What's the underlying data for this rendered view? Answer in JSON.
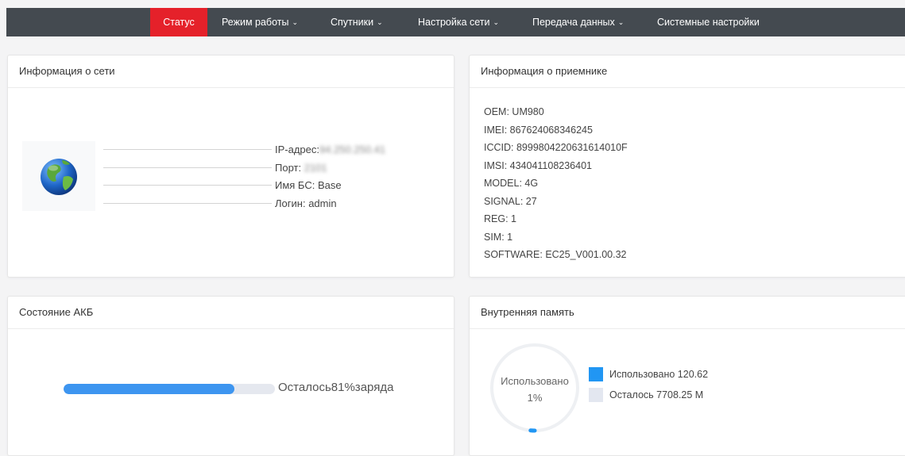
{
  "nav": {
    "items": [
      {
        "label": "Статус",
        "dropdown": false,
        "active": true
      },
      {
        "label": "Режим работы",
        "dropdown": true
      },
      {
        "label": "Спутники",
        "dropdown": true
      },
      {
        "label": "Настройка сети",
        "dropdown": true
      },
      {
        "label": "Передача данных",
        "dropdown": true
      },
      {
        "label": "Системные настройки",
        "dropdown": false
      }
    ],
    "dropdown_icon": "chevron-down-icon",
    "active_color": "#e5212a",
    "bar_color": "#444a50"
  },
  "network": {
    "title": "Информация о сети",
    "icon": "globe-icon",
    "ip_label": "IP-адрес:",
    "ip_value": "94.250.250.41",
    "port_label": "Порт:",
    "port_value": "2101",
    "bs_label": "Имя БС:",
    "bs_value": "Base",
    "login_label": "Логин:",
    "login_value": "admin"
  },
  "receiver": {
    "title": "Информация о приемнике",
    "lines": [
      "OEM: UM980",
      "IMEI: 867624068346245",
      "ICCID: 8999804220631614010F",
      "IMSI: 434041108236401",
      "MODEL: 4G",
      "SIGNAL: 27",
      "REG: 1",
      "SIM: 1",
      "SOFTWARE: EC25_V001.00.32"
    ]
  },
  "battery": {
    "title": "Состояние АКБ",
    "level_percent": 81,
    "label": "Осталось81%заряда",
    "bar_color": "#3d95f0"
  },
  "memory": {
    "title": "Внутренняя память",
    "gauge_label": "Использовано",
    "used_percent_text": "1%",
    "used_fraction": 0.0154,
    "legend": [
      {
        "label": "Использовано 120.62",
        "color": "#2196f3"
      },
      {
        "label": "Осталось 7708.25 M",
        "color": "#e3e7f0"
      }
    ]
  }
}
